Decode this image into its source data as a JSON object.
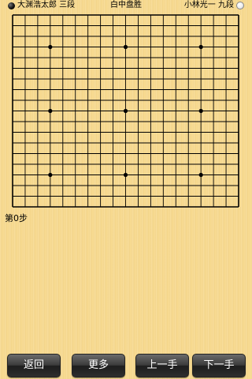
{
  "header": {
    "black_player": "大渊浩太郎 三段",
    "result": "白中盘胜",
    "white_player": "小林光一 九段"
  },
  "board": {
    "size": 19,
    "star_points": [
      [
        3,
        3
      ],
      [
        9,
        3
      ],
      [
        15,
        3
      ],
      [
        3,
        9
      ],
      [
        9,
        9
      ],
      [
        15,
        9
      ],
      [
        3,
        15
      ],
      [
        9,
        15
      ],
      [
        15,
        15
      ]
    ],
    "line_color": "#000000"
  },
  "status": {
    "move_count": "第0步"
  },
  "footer": {
    "back_label": "返回",
    "more_label": "更多",
    "prev_label": "上一手",
    "next_label": "下一手"
  }
}
